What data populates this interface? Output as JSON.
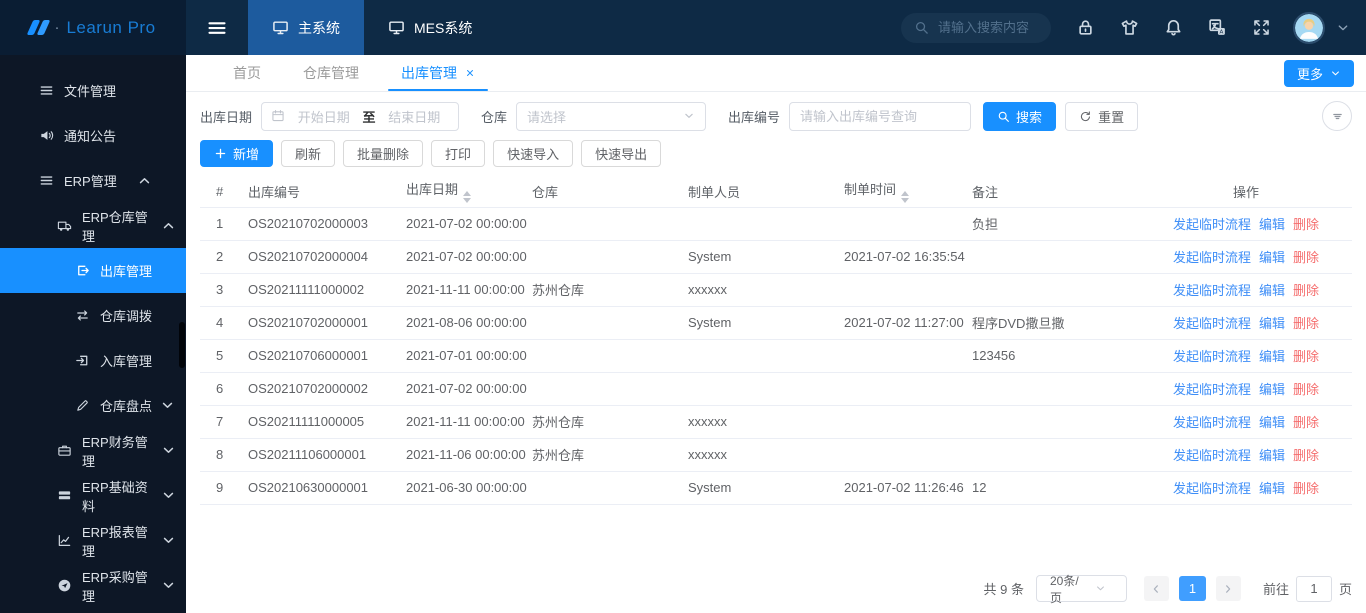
{
  "header": {
    "logo_text": "Learun Pro",
    "logo_dot": "·",
    "nav_tabs": [
      {
        "label": "主系统",
        "icon": "monitor-icon",
        "active": true
      },
      {
        "label": "MES系统",
        "icon": "monitor-icon",
        "active": false
      }
    ],
    "search_placeholder": "请输入搜索内容",
    "action_icons": [
      "lock-icon",
      "theme-tshirt-icon",
      "bell-icon",
      "translate-icon",
      "fullscreen-icon"
    ]
  },
  "sidebar": {
    "items": [
      {
        "label": "文件管理",
        "icon": "list-icon",
        "level": 1
      },
      {
        "label": "通知公告",
        "icon": "speaker-icon",
        "level": 1
      },
      {
        "label": "ERP管理",
        "icon": "list-icon",
        "level": 1,
        "chevron": "up",
        "chevron_end": true
      },
      {
        "label": "ERP仓库管理",
        "icon": "truck-icon",
        "level": 2,
        "chevron": "up"
      },
      {
        "label": "出库管理",
        "icon": "export-icon",
        "level": 3,
        "active": true
      },
      {
        "label": "仓库调拨",
        "icon": "transfer-icon",
        "level": 3
      },
      {
        "label": "入库管理",
        "icon": "import-icon",
        "level": 3
      },
      {
        "label": "仓库盘点",
        "icon": "pencil-icon",
        "level": 3,
        "chevron": "down"
      },
      {
        "label": "ERP财务管理",
        "icon": "briefcase-icon",
        "level": 2,
        "chevron": "down"
      },
      {
        "label": "ERP基础资料",
        "icon": "stack-icon",
        "level": 2,
        "chevron": "down"
      },
      {
        "label": "ERP报表管理",
        "icon": "chart-icon",
        "level": 2,
        "chevron": "down"
      },
      {
        "label": "ERP采购管理",
        "icon": "send-icon",
        "level": 2,
        "chevron": "down"
      }
    ]
  },
  "tabbar": {
    "tabs": [
      {
        "label": "首页"
      },
      {
        "label": "仓库管理"
      },
      {
        "label": "出库管理",
        "active": true,
        "closable": true
      }
    ],
    "more_label": "更多"
  },
  "filters": {
    "date_label": "出库日期",
    "date_start_placeholder": "开始日期",
    "date_separator": "至",
    "date_end_placeholder": "结束日期",
    "warehouse_label": "仓库",
    "warehouse_placeholder": "请选择",
    "code_label": "出库编号",
    "code_placeholder": "请输入出库编号查询",
    "search_label": "搜索",
    "reset_label": "重置"
  },
  "toolbar": {
    "add_label": "新增",
    "buttons": [
      "刷新",
      "批量删除",
      "打印",
      "快速导入",
      "快速导出"
    ]
  },
  "table": {
    "columns": [
      {
        "label": "#"
      },
      {
        "label": "出库编号"
      },
      {
        "label": "出库日期",
        "sortable": true
      },
      {
        "label": "仓库"
      },
      {
        "label": "制单人员"
      },
      {
        "label": "制单时间",
        "sortable": true
      },
      {
        "label": "备注"
      },
      {
        "label": "操作"
      }
    ],
    "actions": {
      "flow": "发起临时流程",
      "edit": "编辑",
      "delete": "删除"
    },
    "rows": [
      {
        "idx": "1",
        "code": "OS20210702000003",
        "date": "2021-07-02 00:00:00",
        "warehouse": "",
        "maker": "",
        "time": "",
        "note": "负担"
      },
      {
        "idx": "2",
        "code": "OS20210702000004",
        "date": "2021-07-02 00:00:00",
        "warehouse": "",
        "maker": "System",
        "time": "2021-07-02 16:35:54",
        "note": ""
      },
      {
        "idx": "3",
        "code": "OS20211111000002",
        "date": "2021-11-11 00:00:00",
        "warehouse": "苏州仓库",
        "maker": "xxxxxx",
        "time": "",
        "note": ""
      },
      {
        "idx": "4",
        "code": "OS20210702000001",
        "date": "2021-08-06 00:00:00",
        "warehouse": "",
        "maker": "System",
        "time": "2021-07-02 11:27:00",
        "note": "程序DVD撒旦撒"
      },
      {
        "idx": "5",
        "code": "OS20210706000001",
        "date": "2021-07-01 00:00:00",
        "warehouse": "",
        "maker": "",
        "time": "",
        "note": "123456"
      },
      {
        "idx": "6",
        "code": "OS20210702000002",
        "date": "2021-07-02 00:00:00",
        "warehouse": "",
        "maker": "",
        "time": "",
        "note": ""
      },
      {
        "idx": "7",
        "code": "OS20211111000005",
        "date": "2021-11-11 00:00:00",
        "warehouse": "苏州仓库",
        "maker": "xxxxxx",
        "time": "",
        "note": ""
      },
      {
        "idx": "8",
        "code": "OS20211106000001",
        "date": "2021-11-06 00:00:00",
        "warehouse": "苏州仓库",
        "maker": "xxxxxx",
        "time": "",
        "note": ""
      },
      {
        "idx": "9",
        "code": "OS20210630000001",
        "date": "2021-06-30 00:00:00",
        "warehouse": "",
        "maker": "System",
        "time": "2021-07-02 11:26:46",
        "note": "12"
      }
    ]
  },
  "pagination": {
    "total": "共 9 条",
    "page_size": "20条/页",
    "current_page": "1",
    "goto_label": "前往",
    "goto_value": "1",
    "page_unit": "页"
  },
  "colors": {
    "accent": "#1890ff",
    "header_bg": "#0e2a45",
    "header_active_tab": "#1d5b9e",
    "sidebar_bg": "#0d1726",
    "link": "#3e8ef7",
    "danger": "#f56c6c",
    "pagination_active": "#409eff"
  }
}
